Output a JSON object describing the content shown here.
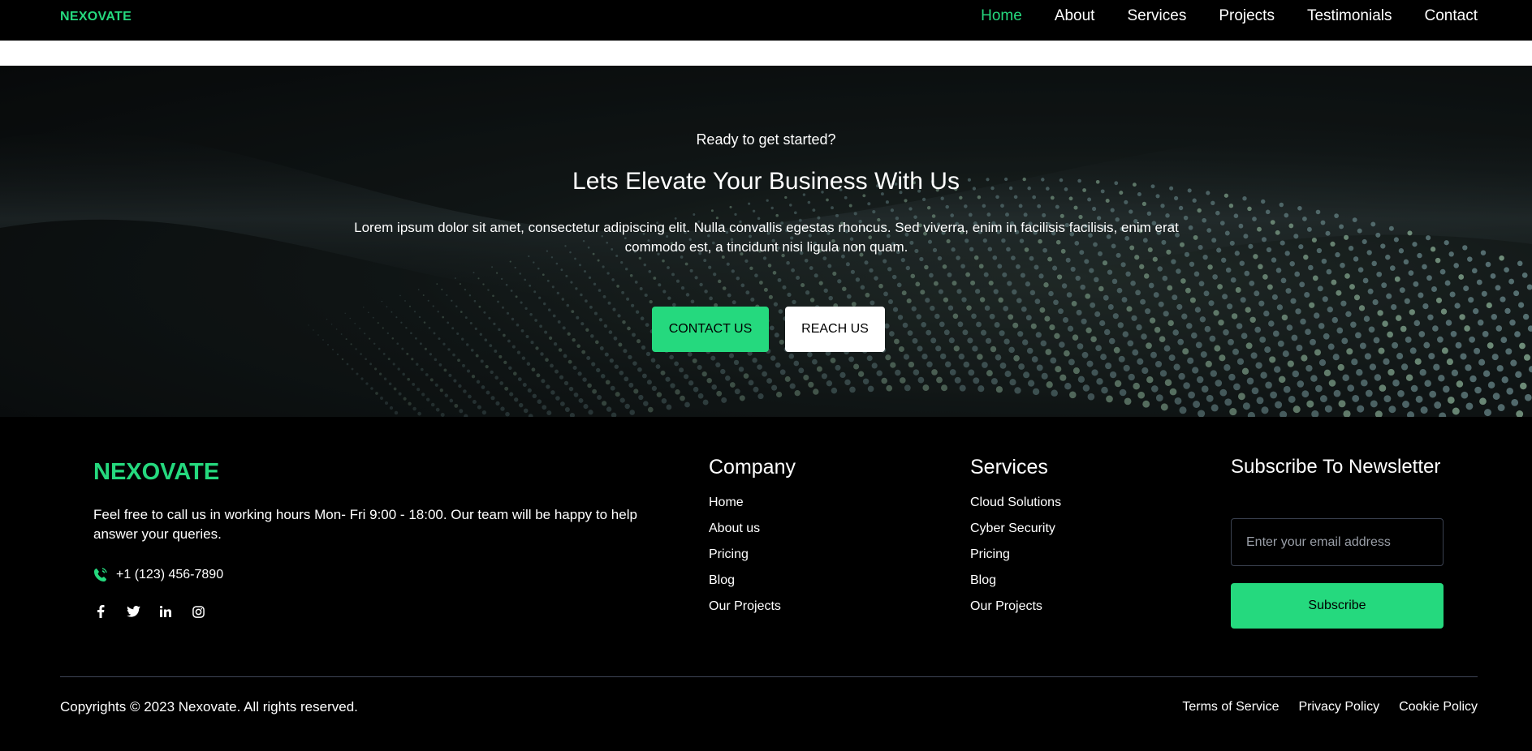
{
  "nav": {
    "brand": "NEXOVATE",
    "links": [
      "Home",
      "About",
      "Services",
      "Projects",
      "Testimonials",
      "Contact"
    ],
    "active": "Home"
  },
  "hero": {
    "kicker": "Ready to get started?",
    "title": "Lets Elevate Your Business With Us",
    "description": "Lorem ipsum dolor sit amet, consectetur adipiscing elit. Nulla convallis egestas rhoncus. Sed viverra, enim in facilisis facilisis, enim erat commodo est, a tincidunt nisi ligula non quam.",
    "contact_label": "CONTACT US",
    "reach_label": "REACH US"
  },
  "footer": {
    "brand": "NEXOVATE",
    "description": "Feel free to call us in working hours Mon- Fri 9:00 - 18:00. Our team will be happy to help answer your queries.",
    "phone": "+1 (123) 456-7890",
    "socials": [
      "facebook-icon",
      "twitter-icon",
      "linkedin-icon",
      "instagram-icon"
    ],
    "company": {
      "title": "Company",
      "items": [
        "Home",
        "About us",
        "Pricing",
        "Blog",
        "Our Projects"
      ]
    },
    "services": {
      "title": "Services",
      "items": [
        "Cloud Solutions",
        "Cyber Security",
        "Pricing",
        "Blog",
        "Our Projects"
      ]
    },
    "newsletter": {
      "title": "Subscribe To Newsletter",
      "placeholder": "Enter your email address",
      "button": "Subscribe"
    },
    "copyright": "Copyrights © 2023 Nexovate. All rights reserved.",
    "legal": [
      "Terms of Service",
      "Privacy Policy",
      "Cookie Policy"
    ]
  },
  "colors": {
    "accent": "#25d97e",
    "background": "#000000",
    "divider": "#3f4657"
  }
}
